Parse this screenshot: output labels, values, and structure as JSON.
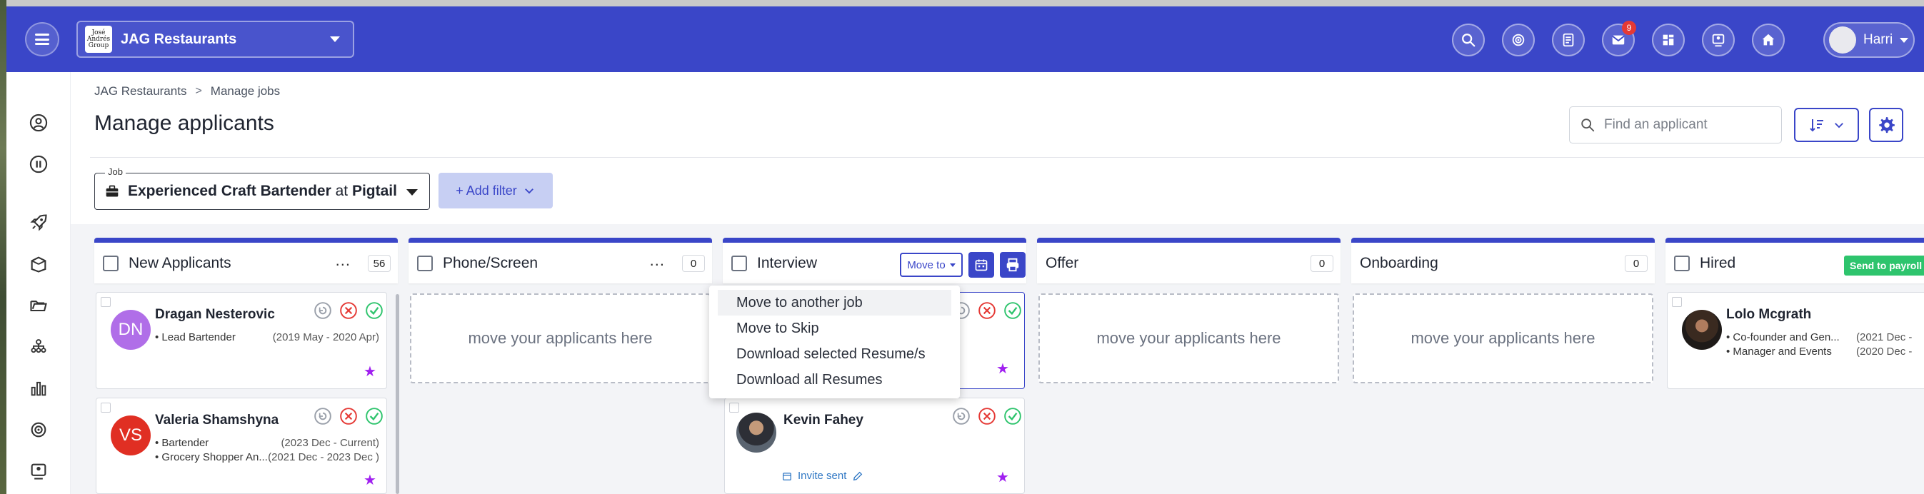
{
  "header": {
    "org_name": "JAG Restaurants",
    "org_logo_text": "José Andrés Group",
    "user_name": "Harri",
    "notification_count": "9",
    "icons": [
      "search-icon",
      "target-icon",
      "document-icon",
      "mail-icon",
      "dashboard-icon",
      "contacts-icon",
      "home-icon"
    ]
  },
  "breadcrumb": {
    "items": [
      "JAG Restaurants",
      "Manage jobs"
    ],
    "separator": ">"
  },
  "page": {
    "title": "Manage applicants"
  },
  "search": {
    "placeholder": "Find an applicant"
  },
  "job_filter": {
    "legend": "Job",
    "job_title": "Experienced Craft Bartender",
    "at": "at",
    "location": "Pigtail",
    "add_filter_label": "+ Add filter"
  },
  "columns": [
    {
      "title": "New Applicants",
      "count": "56",
      "menu": "..."
    },
    {
      "title": "Phone/Screen",
      "count": "0",
      "menu": "...",
      "placeholder": "move your applicants here"
    },
    {
      "title": "Interview",
      "move_to_label": "Move to"
    },
    {
      "title": "Offer",
      "count": "0",
      "placeholder": "move your applicants here"
    },
    {
      "title": "Onboarding",
      "count": "0",
      "placeholder": "move your applicants here"
    },
    {
      "title": "Hired",
      "action_label": "Send to payroll"
    }
  ],
  "cards": {
    "dragan": {
      "initials": "DN",
      "name": "Dragan Nesterovic",
      "role": "Lead Bartender",
      "dates": "(2019 May - 2020 Apr)",
      "avatar_color": "#b06ee8"
    },
    "valeria": {
      "initials": "VS",
      "name": "Valeria Shamshyna",
      "role1": "Bartender",
      "dates1": "(2023 Dec - Current)",
      "role2": "Grocery Shopper An...",
      "dates2": "(2021 Dec - 2023 Dec )",
      "avatar_color": "#e02f23"
    },
    "kevin": {
      "name": "Kevin Fahey",
      "invite_label": "Invite sent"
    },
    "lolo": {
      "name": "Lolo Mcgrath",
      "role1": "Co-founder and Gen...",
      "dates1": "(2021 Dec -",
      "role2": "Manager and Events",
      "dates2": "(2020 Dec -"
    }
  },
  "move_to_menu": {
    "items": [
      "Move to another job",
      "Move to Skip",
      "Download selected Resume/s",
      "Download all Resumes"
    ]
  },
  "colors": {
    "brand": "#3a46c8",
    "star": "#a020f0",
    "accept": "#2ec46d",
    "reject": "#e53935",
    "payroll": "#2ec46d"
  }
}
